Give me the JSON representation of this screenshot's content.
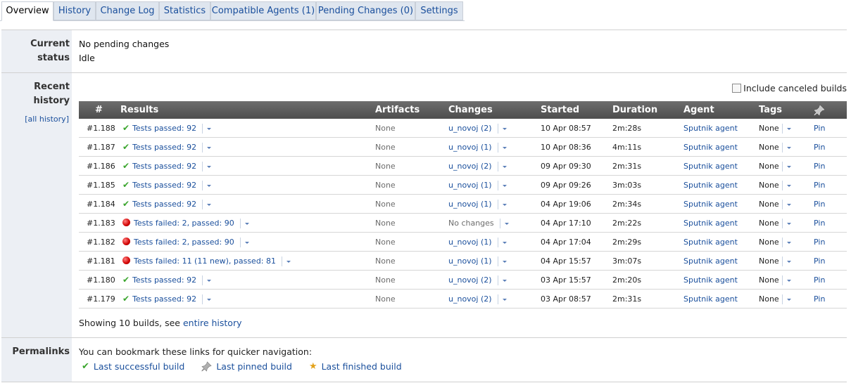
{
  "tabs": [
    {
      "label": "Overview",
      "active": true
    },
    {
      "label": "History"
    },
    {
      "label": "Change Log"
    },
    {
      "label": "Statistics"
    },
    {
      "label": "Compatible Agents (1)"
    },
    {
      "label": "Pending Changes (0)"
    },
    {
      "label": "Settings"
    }
  ],
  "current_status": {
    "label_line1": "Current",
    "label_line2": "status",
    "line1": "No pending changes",
    "line2": "Idle"
  },
  "recent_history": {
    "label_line1": "Recent",
    "label_line2": "history",
    "all_history_link": "[all history]",
    "include_canceled_label": "Include canceled builds",
    "columns": [
      "#",
      "Results",
      "Artifacts",
      "Changes",
      "Started",
      "Duration",
      "Agent",
      "Tags"
    ],
    "pin_column_icon": "pin-icon",
    "rows": [
      {
        "number": "#1.188",
        "status": "success",
        "result": "Tests passed: 92",
        "artifacts": "None",
        "changes": "u_novoj (2)",
        "started": "10 Apr 08:57",
        "duration": "2m:28s",
        "agent": "Sputnik agent",
        "tags": "None",
        "pin": "Pin"
      },
      {
        "number": "#1.187",
        "status": "success",
        "result": "Tests passed: 92",
        "artifacts": "None",
        "changes": "u_novoj (1)",
        "started": "10 Apr 08:36",
        "duration": "4m:11s",
        "agent": "Sputnik agent",
        "tags": "None",
        "pin": "Pin"
      },
      {
        "number": "#1.186",
        "status": "success",
        "result": "Tests passed: 92",
        "artifacts": "None",
        "changes": "u_novoj (2)",
        "started": "09 Apr 09:30",
        "duration": "2m:31s",
        "agent": "Sputnik agent",
        "tags": "None",
        "pin": "Pin"
      },
      {
        "number": "#1.185",
        "status": "success",
        "result": "Tests passed: 92",
        "artifacts": "None",
        "changes": "u_novoj (1)",
        "started": "09 Apr 09:26",
        "duration": "3m:03s",
        "agent": "Sputnik agent",
        "tags": "None",
        "pin": "Pin"
      },
      {
        "number": "#1.184",
        "status": "success",
        "result": "Tests passed: 92",
        "artifacts": "None",
        "changes": "u_novoj (1)",
        "started": "04 Apr 19:06",
        "duration": "2m:34s",
        "agent": "Sputnik agent",
        "tags": "None",
        "pin": "Pin"
      },
      {
        "number": "#1.183",
        "status": "failure",
        "result": "Tests failed: 2, passed: 90",
        "artifacts": "None",
        "changes": "No changes",
        "started": "04 Apr 17:10",
        "duration": "2m:22s",
        "agent": "Sputnik agent",
        "tags": "None",
        "pin": "Pin"
      },
      {
        "number": "#1.182",
        "status": "failure",
        "result": "Tests failed: 2, passed: 90",
        "artifacts": "None",
        "changes": "u_novoj (1)",
        "started": "04 Apr 17:04",
        "duration": "2m:29s",
        "agent": "Sputnik agent",
        "tags": "None",
        "pin": "Pin"
      },
      {
        "number": "#1.181",
        "status": "failure",
        "result": "Tests failed: 11 (11 new), passed: 81",
        "artifacts": "None",
        "changes": "u_novoj (1)",
        "started": "04 Apr 15:57",
        "duration": "3m:07s",
        "agent": "Sputnik agent",
        "tags": "None",
        "pin": "Pin"
      },
      {
        "number": "#1.180",
        "status": "success",
        "result": "Tests passed: 92",
        "artifacts": "None",
        "changes": "u_novoj (2)",
        "started": "03 Apr 15:57",
        "duration": "2m:20s",
        "agent": "Sputnik agent",
        "tags": "None",
        "pin": "Pin"
      },
      {
        "number": "#1.179",
        "status": "success",
        "result": "Tests passed: 92",
        "artifacts": "None",
        "changes": "u_novoj (2)",
        "started": "03 Apr 08:57",
        "duration": "2m:31s",
        "agent": "Sputnik agent",
        "tags": "None",
        "pin": "Pin"
      }
    ],
    "showing_prefix": "Showing 10 builds, see ",
    "showing_link": "entire history"
  },
  "permalinks": {
    "label": "Permalinks",
    "text": "You can bookmark these links for quicker navigation:",
    "links": [
      {
        "label": "Last successful build",
        "icon": "check-icon"
      },
      {
        "label": "Last pinned build",
        "icon": "pin-icon"
      },
      {
        "label": "Last finished build",
        "icon": "star-icon"
      }
    ]
  },
  "colors": {
    "link": "#1a4f9c",
    "success": "#3aa52d",
    "failure": "#d10000",
    "header_bg": "#5a5a5a",
    "left_column_bg": "#eceff4"
  }
}
